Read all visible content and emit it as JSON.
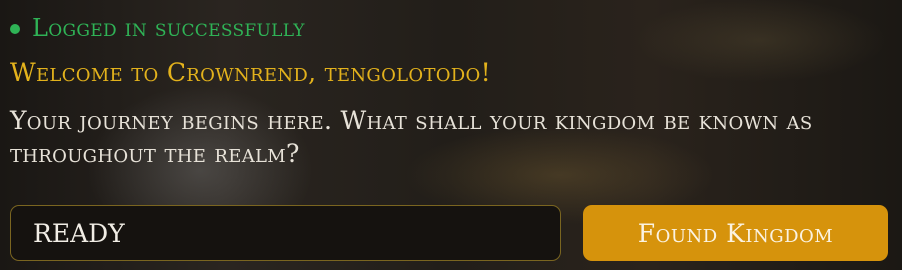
{
  "status": {
    "text": "Logged in successfully",
    "color": "#2fb356"
  },
  "welcome": {
    "text": "Welcome to Crownrend, tengolotodo!",
    "color": "#e3b21c"
  },
  "prompt": {
    "text": "Your journey begins here. What shall your kingdom be known as throughout the realm?"
  },
  "kingdom_input": {
    "value": "READY"
  },
  "found_button": {
    "label": "Found Kingdom",
    "color": "#d6930c"
  }
}
